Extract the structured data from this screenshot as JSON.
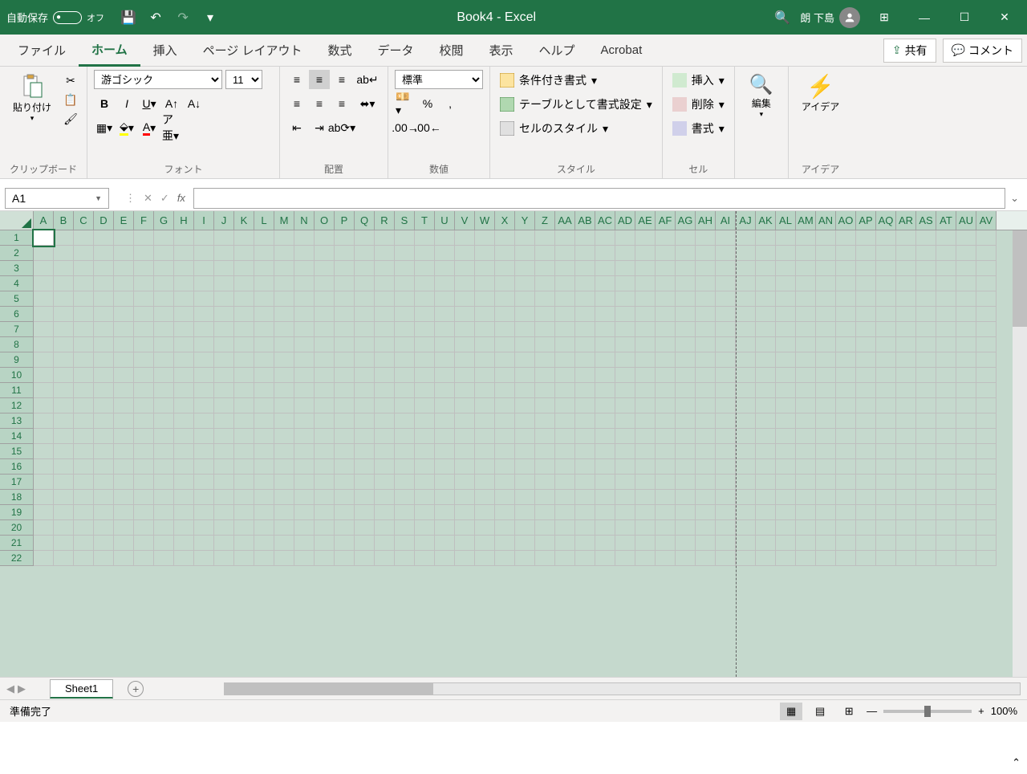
{
  "titlebar": {
    "autosave_label": "自動保存",
    "autosave_state": "オフ",
    "title": "Book4  -  Excel",
    "user": "朗 下島"
  },
  "tabs": {
    "file": "ファイル",
    "home": "ホーム",
    "insert": "挿入",
    "layout": "ページ レイアウト",
    "formulas": "数式",
    "data": "データ",
    "review": "校閲",
    "view": "表示",
    "help": "ヘルプ",
    "acrobat": "Acrobat",
    "share": "共有",
    "comment": "コメント"
  },
  "ribbon": {
    "clipboard": {
      "paste": "貼り付け",
      "label": "クリップボード"
    },
    "font": {
      "name": "游ゴシック",
      "size": "11",
      "label": "フォント"
    },
    "align": {
      "label": "配置"
    },
    "number": {
      "format": "標準",
      "label": "数値"
    },
    "styles": {
      "cond": "条件付き書式",
      "table": "テーブルとして書式設定",
      "cell": "セルのスタイル",
      "label": "スタイル"
    },
    "cells": {
      "insert": "挿入",
      "delete": "削除",
      "format": "書式",
      "label": "セル"
    },
    "editing": {
      "label": "編集"
    },
    "ideas": {
      "btn": "アイデア",
      "label": "アイデア"
    }
  },
  "namebox": "A1",
  "columns": [
    "A",
    "B",
    "C",
    "D",
    "E",
    "F",
    "G",
    "H",
    "I",
    "J",
    "K",
    "L",
    "M",
    "N",
    "O",
    "P",
    "Q",
    "R",
    "S",
    "T",
    "U",
    "V",
    "W",
    "X",
    "Y",
    "Z",
    "AA",
    "AB",
    "AC",
    "AD",
    "AE",
    "AF",
    "AG",
    "AH",
    "AI",
    "AJ",
    "AK",
    "AL",
    "AM",
    "AN",
    "AO",
    "AP",
    "AQ",
    "AR",
    "AS",
    "AT",
    "AU",
    "AV"
  ],
  "rows": [
    "1",
    "2",
    "3",
    "4",
    "5",
    "6",
    "7",
    "8",
    "9",
    "10",
    "11",
    "12",
    "13",
    "14",
    "15",
    "16",
    "17",
    "18",
    "19",
    "20",
    "21",
    "22"
  ],
  "sheet": {
    "name": "Sheet1"
  },
  "status": {
    "ready": "準備完了",
    "zoom": "100%"
  }
}
